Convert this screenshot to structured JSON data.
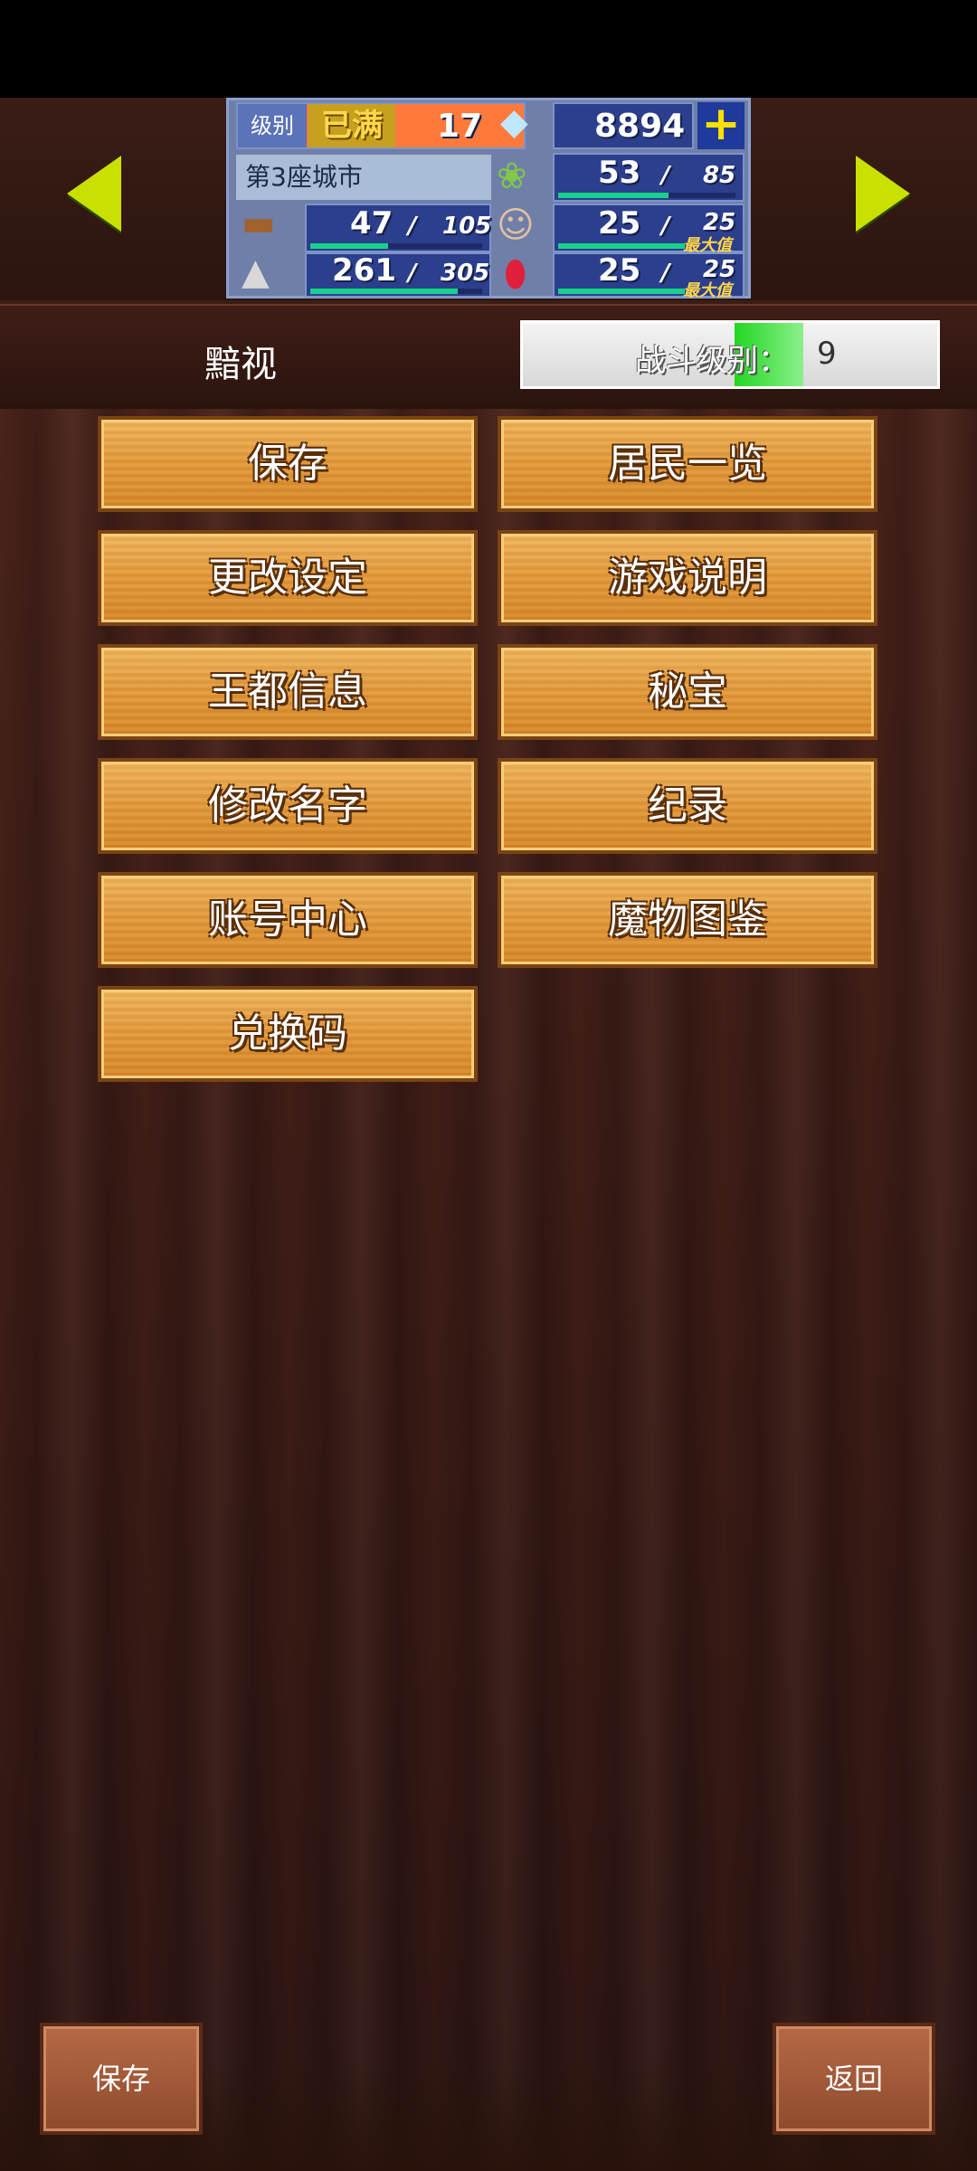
{
  "status": {
    "level_label": "级别",
    "level_badge": "已满",
    "level_value": "17",
    "gems": "8894",
    "plus_symbol": "+",
    "city_name": "第3座城市",
    "food": {
      "current": "53",
      "slash": "/",
      "max": "85",
      "fill": 0.62
    },
    "wood": {
      "current": "47",
      "slash": "/",
      "max": "105",
      "fill": 0.45
    },
    "people": {
      "current": "25",
      "slash": "/",
      "max": "25",
      "max_label": "最大值",
      "fill": 1.0
    },
    "ore": {
      "current": "261",
      "slash": "/",
      "max": "305",
      "fill": 0.86
    },
    "ruby": {
      "current": "25",
      "slash": "/",
      "max": "25",
      "max_label": "最大值",
      "fill": 1.0
    }
  },
  "town": {
    "name": "黯视"
  },
  "battle": {
    "label": "战斗级别：",
    "value": "9"
  },
  "menu": {
    "save": "保存",
    "residents": "居民一览",
    "settings": "更改设定",
    "guide": "游戏说明",
    "capital_info": "王都信息",
    "treasure": "秘宝",
    "rename": "修改名字",
    "records": "纪录",
    "account": "账号中心",
    "monster_book": "魔物图鉴",
    "redeem": "兑换码"
  },
  "bottom": {
    "save": "保存",
    "back": "返回"
  },
  "colors": {
    "accent_green": "#c9e000",
    "button_orange": "#e49a3a",
    "panel_blue": "#2c3f8d"
  },
  "icons": [
    "arrow-left-icon",
    "arrow-right-icon",
    "gem-icon",
    "plus-icon",
    "food-icon",
    "wood-icon",
    "people-icon",
    "ore-icon",
    "ruby-icon"
  ]
}
